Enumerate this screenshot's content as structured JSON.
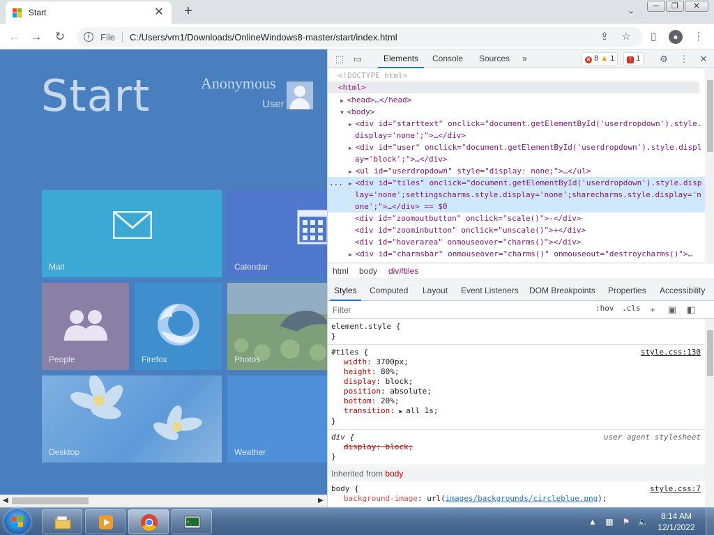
{
  "browser": {
    "tab_title": "Start",
    "tab_close": "✕",
    "new_tab": "+",
    "url_scheme_label": "File",
    "url": "C:/Users/vm1/Downloads/OnlineWindows8-master/start/index.html",
    "window_buttons": [
      "─",
      "❐",
      "✕"
    ]
  },
  "page": {
    "start_title": "Start",
    "user_name": "Anonymous",
    "user_sub": "User",
    "tiles": [
      {
        "label": "Mail",
        "icon": "mail-icon"
      },
      {
        "label": "Calendar",
        "icon": "calendar-icon"
      },
      {
        "label": "People",
        "icon": "people-icon"
      },
      {
        "label": "Firefox",
        "icon": "firefox-icon"
      },
      {
        "label": "Photos",
        "icon": "photo-image"
      },
      {
        "label": "Desktop",
        "icon": "flower-image"
      },
      {
        "label": "Weather",
        "icon": "weather-icon"
      }
    ]
  },
  "devtools": {
    "tabs": [
      "Elements",
      "Console",
      "Sources"
    ],
    "more_tabs": "»",
    "errors": "8",
    "warnings": "1",
    "issues": "1",
    "dom": {
      "doctype": "<!DOCTYPE html>",
      "html_open": "<html>",
      "head": "<head>…</head>",
      "body_open": "<body>",
      "l1": "<div id=\"starttext\" onclick=\"document.getElementById('userdropdown').style.",
      "l1b": "display='none';\">…</div>",
      "l2": "<div id=\"user\" onclick=\"document.getElementById('userdropdown').style.displ",
      "l2b": "ay='block';\">…</div>",
      "l3": "<ul id=\"userdropdown\" style=\"display: none;\">…</ul>",
      "l4": "<div id=\"tiles\" onclick=\"document.getElementById('userdropdown').style.disp",
      "l4b": "lay='none';settingscharms.style.display='none';sharecharms.style.display='n",
      "l4c": "one';\">…</div> == $0",
      "l5": "<div id=\"zoomoutbutton\" onclick=\"scale()\">-</div>",
      "l6": "<div id=\"zoominbutton\" onclick=\"unscale()\">+</div>",
      "l7": "<div id=\"hoverarea\" onmouseover=\"charms()\"></div>",
      "l8": "<div id=\"charmsbar\" onmouseover=\"charms()\" onmouseout=\"destroycharms()\">…",
      "dots": "..."
    },
    "breadcrumbs": [
      "html",
      "body",
      "div#tiles"
    ],
    "subtabs": [
      "Styles",
      "Computed",
      "Layout",
      "Event Listeners",
      "DOM Breakpoints",
      "Properties",
      "Accessibility"
    ],
    "filter_placeholder": "Filter",
    "hov": ":hov",
    "cls": ".cls",
    "styles": {
      "element_style": "element.style {",
      "close": "}",
      "tiles_selector": "#tiles {",
      "tiles_src": "style.css:130",
      "tiles_props": [
        {
          "name": "width",
          "value": "3700px;"
        },
        {
          "name": "height",
          "value": "80%;"
        },
        {
          "name": "display",
          "value": "block;"
        },
        {
          "name": "position",
          "value": "absolute;"
        },
        {
          "name": "bottom",
          "value": "20%;"
        },
        {
          "name": "transition",
          "value": "all 1s;"
        }
      ],
      "div_selector": "div {",
      "div_src": "user agent stylesheet",
      "div_prop": "display: block;",
      "inherited_label": "Inherited from",
      "inherited_from": "body",
      "body_selector": "body {",
      "body_src": "style.css:7",
      "body_prop_name": "background-image",
      "body_prop_url": "images/backgrounds/circleblue.png",
      "body_prop_tail": ");"
    }
  },
  "taskbar": {
    "time": "8:14 AM",
    "date": "12/1/2022",
    "apps": [
      "file-explorer",
      "media-player",
      "chrome",
      "terminal"
    ]
  },
  "colors": {
    "page_bg": "#4a7fbf",
    "mail": "#3ca8d4",
    "calendar": "#4f78cd",
    "people": "#8a7fa5",
    "firefox": "#3f8fce",
    "weather": "#4e8fd8",
    "devtools_accent": "#1a73e8"
  }
}
